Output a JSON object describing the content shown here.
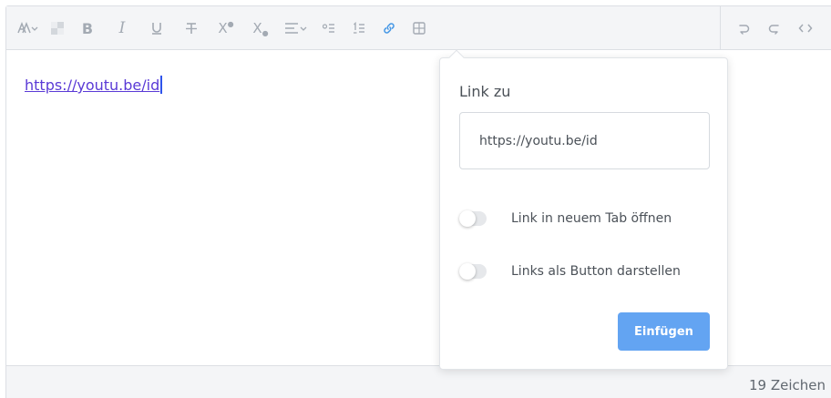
{
  "toolbar": {
    "bold_label": "B",
    "italic_label": "I",
    "superscript_label": "X",
    "subscript_label": "X",
    "accent_color": "#4a9ae6",
    "icon_color": "#a3aab3"
  },
  "editor": {
    "content_text": "https://youtu.be/id"
  },
  "status": {
    "char_count": "19 Zeichen"
  },
  "link_popover": {
    "title": "Link zu",
    "url_value": "https://youtu.be/id",
    "open_new_tab_label": "Link in neuem Tab öffnen",
    "open_new_tab_on": false,
    "as_button_label": "Links als Button darstellen",
    "as_button_on": false,
    "insert_label": "Einfügen",
    "insert_color": "#63a4f2"
  }
}
